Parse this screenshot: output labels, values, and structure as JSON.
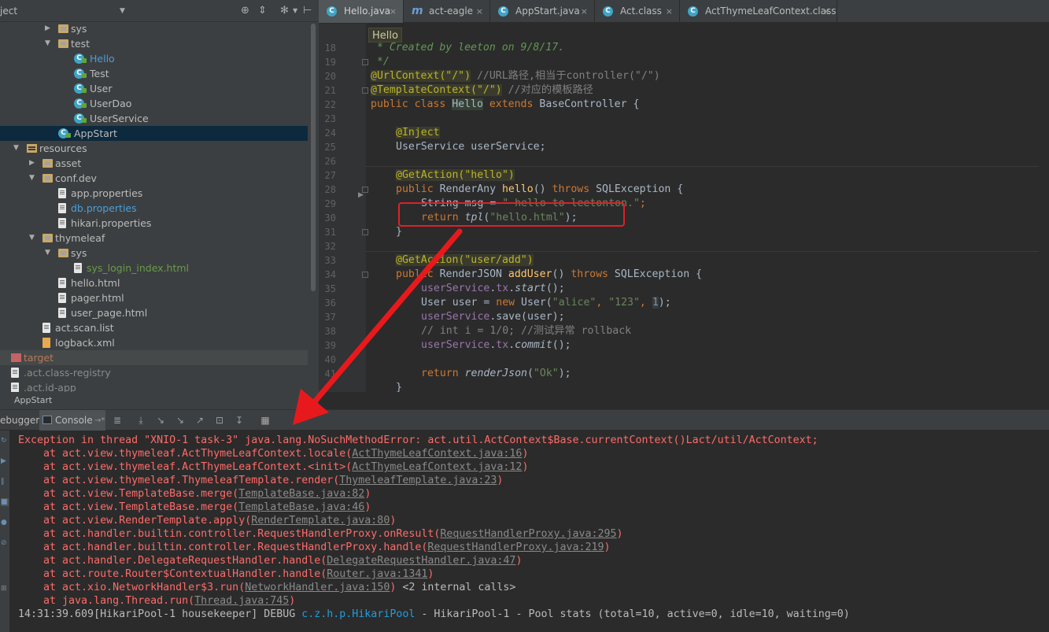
{
  "project": {
    "header_title": "ject",
    "tree": [
      {
        "label": "sys",
        "type": "folder",
        "depth": 3,
        "expanded": false
      },
      {
        "label": "test",
        "type": "folder",
        "depth": 3,
        "expanded": true
      },
      {
        "label": "Hello",
        "type": "class",
        "depth": 4,
        "color": "#4a9eda"
      },
      {
        "label": "Test",
        "type": "class",
        "depth": 4
      },
      {
        "label": "User",
        "type": "class",
        "depth": 4
      },
      {
        "label": "UserDao",
        "type": "class",
        "depth": 4
      },
      {
        "label": "UserService",
        "type": "class",
        "depth": 4
      },
      {
        "label": "AppStart",
        "type": "class",
        "depth": 3,
        "selected": true
      },
      {
        "label": "resources",
        "type": "resfolder",
        "depth": 1,
        "expanded": true
      },
      {
        "label": "asset",
        "type": "folder",
        "depth": 2,
        "expanded": false
      },
      {
        "label": "conf.dev",
        "type": "folder",
        "depth": 2,
        "expanded": true
      },
      {
        "label": "app.properties",
        "type": "file",
        "depth": 3
      },
      {
        "label": "db.properties",
        "type": "file",
        "depth": 3,
        "color": "#4a9eda"
      },
      {
        "label": "hikari.properties",
        "type": "file",
        "depth": 3
      },
      {
        "label": "thymeleaf",
        "type": "folder",
        "depth": 2,
        "expanded": true
      },
      {
        "label": "sys",
        "type": "folder",
        "depth": 3,
        "expanded": true
      },
      {
        "label": "sys_login_index.html",
        "type": "file",
        "depth": 4,
        "color": "#6a9a4a"
      },
      {
        "label": "hello.html",
        "type": "file",
        "depth": 3
      },
      {
        "label": "pager.html",
        "type": "file",
        "depth": 3
      },
      {
        "label": "user_page.html",
        "type": "file",
        "depth": 3
      },
      {
        "label": "act.scan.list",
        "type": "file",
        "depth": 2
      },
      {
        "label": "logback.xml",
        "type": "xml",
        "depth": 2
      },
      {
        "label": "target",
        "type": "redfolder",
        "depth": 0,
        "gray": true,
        "color": "#b97a57"
      },
      {
        "label": ".act.class-registry",
        "type": "file",
        "depth": 0,
        "color": "#8a8a8a"
      },
      {
        "label": ".act.id-app",
        "type": "file",
        "depth": 0,
        "color": "#8a8a8a"
      }
    ]
  },
  "run_bar_label": "AppStart",
  "tabs": [
    {
      "label": "Hello.java",
      "icon": "C",
      "active": true
    },
    {
      "label": "act-eagle",
      "icon": "m"
    },
    {
      "label": "AppStart.java",
      "icon": "C"
    },
    {
      "label": "Act.class",
      "icon": "C"
    },
    {
      "label": "ActThymeLeafContext.class",
      "icon": "C"
    }
  ],
  "breadcrumb": "Hello",
  "editor": {
    "line_numbers": [
      "18",
      "19",
      "20",
      "21",
      "22",
      "23",
      "24",
      "25",
      "26",
      "27",
      "28",
      "29",
      "30",
      "31",
      "32",
      "33",
      "34",
      "35",
      "36",
      "37",
      "38",
      "39",
      "40",
      "41"
    ]
  },
  "code": {
    "l18": " * Created by leeton on 9/8/17.",
    "l19": " */",
    "l20a": "@UrlContext(\"/\")",
    "l20b": " //URL路径,相当于controller(\"/\")",
    "l21a": "@TemplateContext(\"/\")",
    "l21b": " //对应的模板路径",
    "l22a": "public class ",
    "l22b": "Hello",
    "l22c": " extends ",
    "l22d": "BaseController {",
    "l24": "@Inject",
    "l25": "UserService userService;",
    "l27": "@GetAction(\"hello\")",
    "l28a": "public ",
    "l28b": "RenderAny ",
    "l28c": "hello",
    "l28d": "() ",
    "l28e": "throws ",
    "l28f": "SQLException {",
    "l29a": "String msg = ",
    "l29b": "\" hello to leetonton.\"",
    "l29c": ";",
    "l30a": "return ",
    "l30b": "tpl",
    "l30c": "(",
    "l30d": "\"hello.html\"",
    "l30e": ");",
    "l31": "}",
    "l33": "@GetAction(\"user/add\")",
    "l34a": "public ",
    "l34b": "RenderJSON ",
    "l34c": "addUser",
    "l34d": "() ",
    "l34e": "throws ",
    "l34f": "SQLException {",
    "l35a": "userService",
    "l35b": ".",
    "l35c": "tx",
    "l35d": ".",
    "l35e": "start",
    "l35f": "();",
    "l36a": "User user = ",
    "l36b": "new ",
    "l36c": "User(",
    "l36d": "\"alice\"",
    "l36e": ", ",
    "l36f": "\"123\"",
    "l36g": ", ",
    "l36h": "1",
    "l36i": ");",
    "l37a": "userService",
    "l37b": ".save(user);",
    "l38": "// int i = 1/0; //测试异常 rollback",
    "l39a": "userService",
    "l39b": ".",
    "l39c": "tx",
    "l39d": ".",
    "l39e": "commit",
    "l39f": "();",
    "l41a": "return ",
    "l41b": "renderJson",
    "l41c": "(",
    "l41d": "\"Ok\"",
    "l41e": ");",
    "l42": "}"
  },
  "debug_tabs": {
    "debugger": "ebugger",
    "console": "Console"
  },
  "console": {
    "exception": "Exception in thread \"XNIO-1 task-3\" java.lang.NoSuchMethodError: act.util.ActContext$Base.currentContext()Lact/util/ActContext;",
    "stack": [
      {
        "pre": "    at act.view.thymeleaf.ActThymeLeafContext.locale(",
        "link": "ActThymeLeafContext.java:16",
        "post": ")"
      },
      {
        "pre": "    at act.view.thymeleaf.ActThymeLeafContext.<init>(",
        "link": "ActThymeLeafContext.java:12",
        "post": ")"
      },
      {
        "pre": "    at act.view.thymeleaf.ThymeleafTemplate.render(",
        "link": "ThymeleafTemplate.java:23",
        "post": ")"
      },
      {
        "pre": "    at act.view.TemplateBase.merge(",
        "link": "TemplateBase.java:82",
        "post": ")"
      },
      {
        "pre": "    at act.view.TemplateBase.merge(",
        "link": "TemplateBase.java:46",
        "post": ")"
      },
      {
        "pre": "    at act.view.RenderTemplate.apply(",
        "link": "RenderTemplate.java:80",
        "post": ")"
      },
      {
        "pre": "    at act.handler.builtin.controller.RequestHandlerProxy.onResult(",
        "link": "RequestHandlerProxy.java:295",
        "post": ")"
      },
      {
        "pre": "    at act.handler.builtin.controller.RequestHandlerProxy.handle(",
        "link": "RequestHandlerProxy.java:219",
        "post": ")"
      },
      {
        "pre": "    at act.handler.DelegateRequestHandler.handle(",
        "link": "DelegateRequestHandler.java:47",
        "post": ")"
      },
      {
        "pre": "    at act.route.Router$ContextualHandler.handle(",
        "link": "Router.java:1341",
        "post": ")"
      },
      {
        "pre": "    at act.xio.NetworkHandler$3.run(",
        "link": "NetworkHandler.java:150",
        "post": ") ",
        "extra": "<2 internal calls>"
      },
      {
        "pre": "    at java.lang.Thread.run(",
        "link": "Thread.java:745",
        "post": ")"
      }
    ],
    "log_prefix": "14:31:39.609[HikariPool-1 housekeeper] DEBUG ",
    "log_logger": "c.z.h.p.HikariPool",
    "log_msg": " - HikariPool-1 - Pool stats (total=10, active=0, idle=10, waiting=0)"
  }
}
